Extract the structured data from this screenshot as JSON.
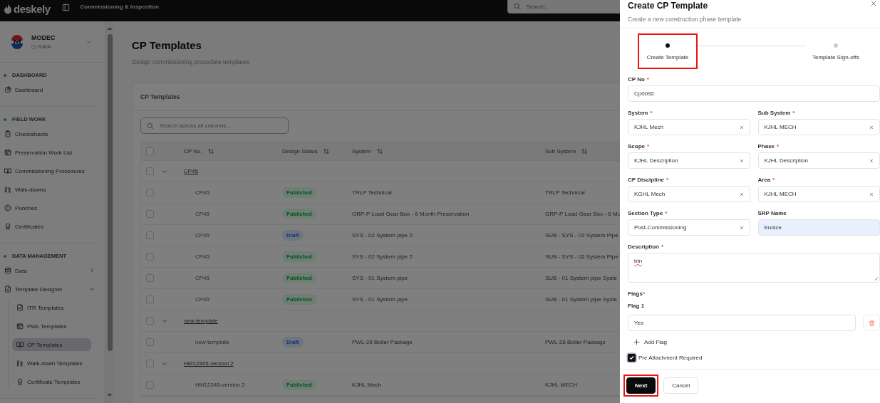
{
  "topbar": {
    "logo": "deskely",
    "module": "Commissioning & Inspection",
    "search": {
      "placeholder": "Search..."
    }
  },
  "sidebar": {
    "org": {
      "name": "MODEC",
      "project": "RAIA"
    },
    "sections": [
      {
        "title": "DASHBOARD",
        "color": "#1e417b",
        "items": [
          {
            "label": "Dashboard",
            "selected": false
          }
        ]
      },
      {
        "title": "FIELD WORK",
        "color": "#11632f",
        "items": [
          {
            "label": "Checksheets",
            "selected": false
          },
          {
            "label": "Preservation Work List",
            "selected": false
          },
          {
            "label": "Commissioning Procedures",
            "selected": false
          },
          {
            "label": "Walk-downs",
            "selected": false
          },
          {
            "label": "Punches",
            "selected": false
          },
          {
            "label": "Certificates",
            "selected": false
          }
        ]
      },
      {
        "title": "DATA MANAGEMENT",
        "color": "#7d3a0b",
        "items": [
          {
            "label": "Data",
            "selected": false,
            "expanded": false
          },
          {
            "label": "Template Designer",
            "selected": false,
            "expanded": true,
            "children": [
              {
                "label": "ITR Templates",
                "selected": false
              },
              {
                "label": "PWL Templates",
                "selected": false
              },
              {
                "label": "CP Templates",
                "selected": true
              },
              {
                "label": "Walk-down Templates",
                "selected": false
              },
              {
                "label": "Certificate Templates",
                "selected": false
              }
            ]
          }
        ]
      }
    ]
  },
  "page": {
    "title": "CP Templates",
    "subtitle": "Design commissioning procedure templates",
    "card": {
      "title": "CP Templates",
      "search": {
        "placeholder": "Search across all columns..."
      },
      "table": {
        "select_all_checked": false,
        "columns": [
          "CP No.",
          "Design Status",
          "System",
          "Sub System"
        ],
        "groups": [
          {
            "name": "CP45",
            "expanded": true,
            "checked": false,
            "rows": [
              {
                "checked": false,
                "cp_no": "CP45",
                "status": {
                  "label": "Published",
                  "kind": "published"
                },
                "system": "TRLP Technical",
                "sub_system": "TRLP Technical"
              },
              {
                "checked": false,
                "cp_no": "CP45",
                "status": {
                  "label": "Published",
                  "kind": "published"
                },
                "system": "GRP-P Load Gear Box - 6 Month Preservation",
                "sub_system": "GRP-P Load Gear Box - 6 Mo"
              },
              {
                "checked": false,
                "cp_no": "CP45",
                "status": {
                  "label": "Draft",
                  "kind": "draft"
                },
                "system": "SYS - 02 System pipe 2",
                "sub_system": "SUB - SYS - 02 System Pipe"
              },
              {
                "checked": false,
                "cp_no": "CP45",
                "status": {
                  "label": "Published",
                  "kind": "published"
                },
                "system": "SYS - 02 System pipe 2",
                "sub_system": "SUB - SYS - 02 System Pipe"
              },
              {
                "checked": false,
                "cp_no": "CP45",
                "status": {
                  "label": "Published",
                  "kind": "published"
                },
                "system": "SYS - 01 System pipe",
                "sub_system": "SUB - 01 System pipe Syste"
              },
              {
                "checked": false,
                "cp_no": "CP45",
                "status": {
                  "label": "Published",
                  "kind": "published"
                },
                "system": "SYS - 01 System pipe",
                "sub_system": "SUB - 01 System pipe Syste"
              }
            ]
          },
          {
            "name": "new template",
            "expanded": true,
            "checked": false,
            "rows": [
              {
                "checked": false,
                "cp_no": "new template",
                "status": {
                  "label": "Draft",
                  "kind": "draft"
                },
                "system": "PWL-26 Boiler Package",
                "sub_system": "PWL-26 Boiler Package"
              }
            ]
          },
          {
            "name": "HM12345-version 2",
            "expanded": true,
            "checked": false,
            "rows": [
              {
                "checked": false,
                "cp_no": "HM12345-version 2",
                "status": {
                  "label": "Published",
                  "kind": "published"
                },
                "system": "KJHL Mech",
                "sub_system": "KJHL MECH"
              }
            ]
          }
        ]
      }
    }
  },
  "drawer": {
    "title": "Create CP Template",
    "subtitle": "Create a new construction phase template",
    "steps": [
      {
        "label": "Create Template",
        "selected": true,
        "highlighted": true
      },
      {
        "label": "Template Sign-offs",
        "selected": false,
        "highlighted": false
      }
    ],
    "rows": [
      [
        {
          "kind": "text",
          "label": "CP No",
          "required_mark": "*",
          "value": "Cp0092"
        }
      ],
      [
        {
          "kind": "select",
          "label": "System",
          "required_mark": "*",
          "value": "KJHL Mech"
        },
        {
          "kind": "select",
          "label": "Sub System",
          "required_mark": "*",
          "value": "KJHL MECH"
        }
      ],
      [
        {
          "kind": "select",
          "label": "Scope",
          "required_mark": "*",
          "value": "KJHL Description"
        },
        {
          "kind": "select",
          "label": "Phase",
          "required_mark": "*",
          "value": "KJHL Description"
        }
      ],
      [
        {
          "kind": "select",
          "label": "CP Discipline",
          "required_mark": "*",
          "value": "KGHL Mech"
        },
        {
          "kind": "select",
          "label": "Area",
          "required_mark": "*",
          "value": "KJHL MECH"
        }
      ],
      [
        {
          "kind": "select",
          "label": "Section Type",
          "required_mark": "*",
          "value": "Post-Commissioning"
        },
        {
          "kind": "text",
          "label": "SRP Name",
          "value": "Eunice",
          "autofilled": true
        }
      ],
      [
        {
          "kind": "textarea",
          "label": "Description",
          "required_mark": "*",
          "value": "btn",
          "misspelled": true
        }
      ]
    ],
    "flags": {
      "label": "Flags",
      "required_mark": "*",
      "items": [
        {
          "label": "Flag 1",
          "value": "Yes"
        }
      ],
      "add_label": "Add Flag"
    },
    "checkbox": {
      "label": "Pre Attachment Required",
      "checked": true
    },
    "buttons": [
      {
        "label": "Next",
        "kind": "primary",
        "highlighted": true
      },
      {
        "label": "Cancel",
        "kind": "secondary",
        "highlighted": false
      }
    ]
  }
}
